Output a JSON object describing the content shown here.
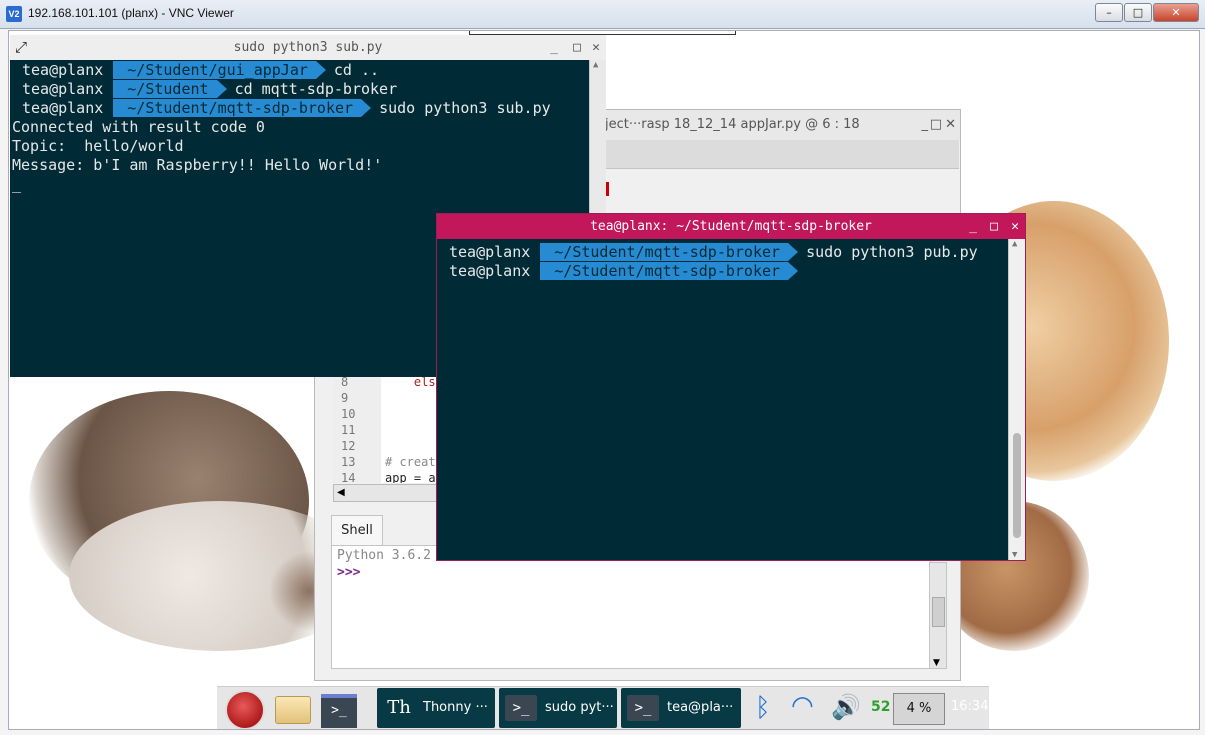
{
  "vnc": {
    "title": "192.168.101.101 (planx) - VNC Viewer",
    "icon": "vnc-icon",
    "buttons": {
      "minimize": "–",
      "maximize": "□",
      "close": "✕"
    }
  },
  "colors": {
    "terminal_bg": "#002b36",
    "path_segment": "#268bd2",
    "active_titlebar": "#c2185b",
    "inactive_titlebar": "#eeeeee",
    "taskbar_task": "#083a45"
  },
  "terminal_sub": {
    "title": "sudo python3 sub.py",
    "buttons": [
      "_",
      "□",
      "✕"
    ],
    "prompts": [
      {
        "user": "tea@planx",
        "path": "~/Student/gui_appJar",
        "cmd": "cd .."
      },
      {
        "user": "tea@planx",
        "path": "~/Student",
        "cmd": "cd mqtt-sdp-broker"
      },
      {
        "user": "tea@planx",
        "path": "~/Student/mqtt-sdp-broker",
        "cmd": "sudo python3 sub.py"
      }
    ],
    "output": [
      "Connected with result code 0",
      "Topic:  hello/world",
      "Message: b'I am Raspberry!! Hello World!'",
      "_"
    ]
  },
  "terminal_pub": {
    "title": "tea@planx: ~/Student/mqtt-sdp-broker",
    "buttons": [
      "_",
      "□",
      "✕"
    ],
    "prompts": [
      {
        "user": "tea@planx",
        "path": "~/Student/mqtt-sdp-broker",
        "cmd": "sudo python3 pub.py"
      },
      {
        "user": "tea@planx",
        "path": "~/Student/mqtt-sdp-broker",
        "cmd": ""
      }
    ]
  },
  "thonny": {
    "title": "ject···rasp 18_12_14 appJar.py  @  6 : 18",
    "buttons": [
      "_",
      "□",
      "✕"
    ],
    "line_numbers": [
      "8",
      "9",
      "10",
      "11",
      "12",
      "13",
      "14"
    ],
    "code_lines": [
      "    els",
      "",
      "",
      "",
      "",
      "# creat",
      "app = a"
    ],
    "shell_tab": "Shell",
    "shell_version": "Python 3.6.2",
    "shell_prompt": ">>>"
  },
  "taskbar": {
    "icons": [
      "raspberry-menu-icon",
      "file-manager-icon",
      "terminal-launcher-icon"
    ],
    "tasks": [
      {
        "icon": "Th",
        "label": "Thonny  ···"
      },
      {
        "icon": ">_",
        "label": "sudo pyt···"
      },
      {
        "icon": ">_",
        "label": "tea@pla···"
      }
    ],
    "tray": {
      "volume_level": "52",
      "cpu": "4 %",
      "clock": "16:34"
    }
  }
}
